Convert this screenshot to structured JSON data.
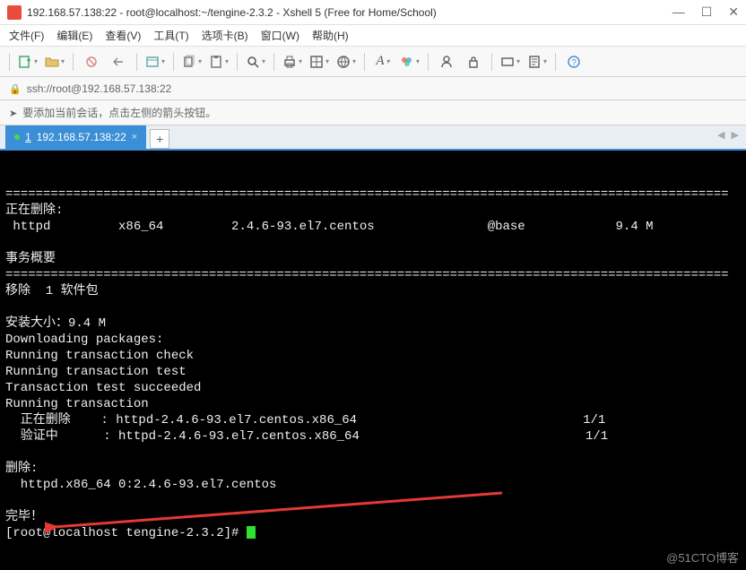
{
  "titlebar": {
    "title": "192.168.57.138:22 - root@localhost:~/tengine-2.3.2 - Xshell 5 (Free for Home/School)"
  },
  "menubar": {
    "file": "文件(F)",
    "edit": "编辑(E)",
    "view": "查看(V)",
    "tools": "工具(T)",
    "tabs": "选项卡(B)",
    "window": "窗口(W)",
    "help": "帮助(H)"
  },
  "addressbar": {
    "url": "ssh://root@192.168.57.138:22"
  },
  "hintbar": {
    "text": "要添加当前会话，点击左侧的箭头按钮。"
  },
  "tabs": {
    "active": {
      "index": "1",
      "label": "192.168.57.138:22"
    }
  },
  "terminal": {
    "lines": [
      "",
      "================================================================================================",
      "正在删除:",
      " httpd         x86_64         2.4.6-93.el7.centos               @base            9.4 M",
      "",
      "事务概要",
      "================================================================================================",
      "移除  1 软件包",
      "",
      "安装大小：9.4 M",
      "Downloading packages:",
      "Running transaction check",
      "Running transaction test",
      "Transaction test succeeded",
      "Running transaction",
      "  正在删除    : httpd-2.4.6-93.el7.centos.x86_64                              1/1",
      "  验证中      : httpd-2.4.6-93.el7.centos.x86_64                              1/1",
      "",
      "删除:",
      "  httpd.x86_64 0:2.4.6-93.el7.centos",
      "",
      "完毕！",
      "[root@localhost tengine-2.3.2]# "
    ]
  },
  "watermark": "@51CTO博客"
}
